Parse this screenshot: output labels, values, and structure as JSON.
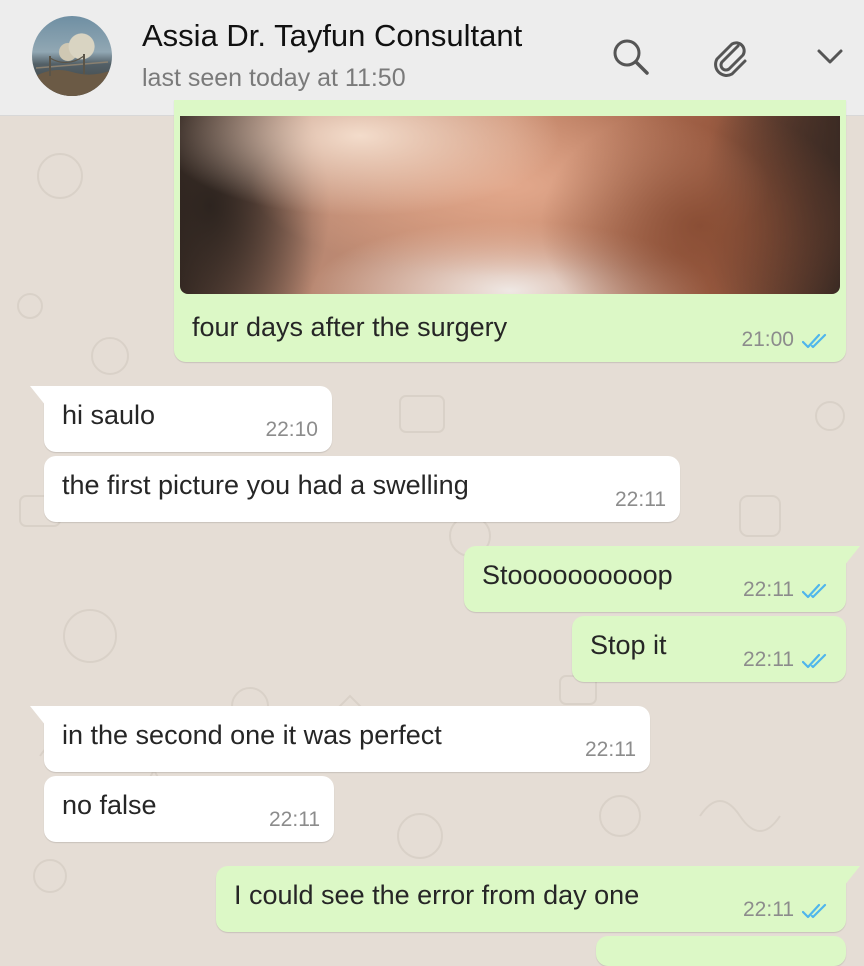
{
  "header": {
    "contact_name": "Assia Dr. Tayfun Consultant",
    "status": "last seen today at 11:50",
    "icons": [
      "search-icon",
      "paperclip-icon",
      "chevron-down-icon"
    ]
  },
  "messages": [
    {
      "direction": "out",
      "text": "four days after the surgery",
      "time": "21:00",
      "read": true,
      "has_image": true
    },
    {
      "direction": "in",
      "text": "hi saulo",
      "time": "22:10"
    },
    {
      "direction": "in",
      "text": "the first picture you had a swelling",
      "time": "22:11"
    },
    {
      "direction": "out",
      "text": "Stoooooooooop",
      "time": "22:11",
      "read": true
    },
    {
      "direction": "out",
      "text": "Stop it",
      "time": "22:11",
      "read": true
    },
    {
      "direction": "in",
      "text": "in the second one it was perfect",
      "time": "22:11"
    },
    {
      "direction": "in",
      "text": "no false",
      "time": "22:11"
    },
    {
      "direction": "out",
      "text": "I could see the error from day one",
      "time": "22:11",
      "read": true
    }
  ],
  "colors": {
    "incoming_bubble": "#ffffff",
    "outgoing_bubble": "#dcf8c6",
    "read_ticks": "#4fb6ec",
    "chat_background": "#e5ddd5",
    "header_background": "#ededed"
  }
}
